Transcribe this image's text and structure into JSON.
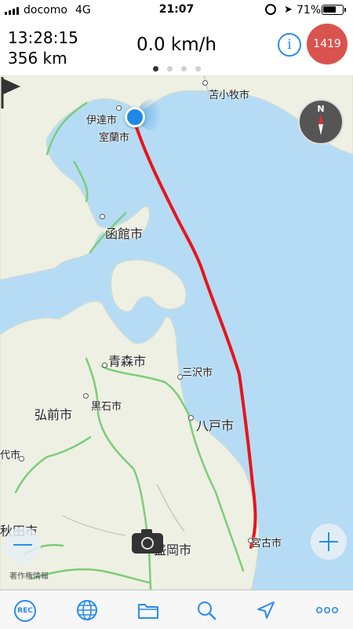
{
  "status_bar": {
    "carrier": "docomo",
    "network": "4G",
    "time": "21:07",
    "battery_percent": "71%",
    "battery_level": 0.71
  },
  "header": {
    "elapsed_time": "13:28:15",
    "distance": "356 km",
    "speed": "0.0 km/h",
    "photo_count": "1419",
    "info_icon": "info-icon",
    "page_dots": {
      "count": 4,
      "active_index": 0
    }
  },
  "map": {
    "labels": {
      "tomakomai": "苫小牧市",
      "date": "伊達市",
      "muroran": "室蘭市",
      "hakodate": "函館市",
      "aomori": "青森市",
      "misawa": "三沢市",
      "hirosaki": "弘前市",
      "kuroishi": "黒石市",
      "hachinohe": "八戸市",
      "shiro": "代市",
      "akita": "秋田市",
      "morioka": "盛岡市",
      "miyako": "宮古市"
    },
    "attribution": "著作権情報",
    "compass_label": "N",
    "route_color": "#e8141b"
  },
  "toolbar": {
    "rec_label": "REC",
    "icons": [
      "rec-icon",
      "globe-icon",
      "folder-icon",
      "search-icon",
      "location-arrow-icon",
      "more-icon"
    ]
  }
}
